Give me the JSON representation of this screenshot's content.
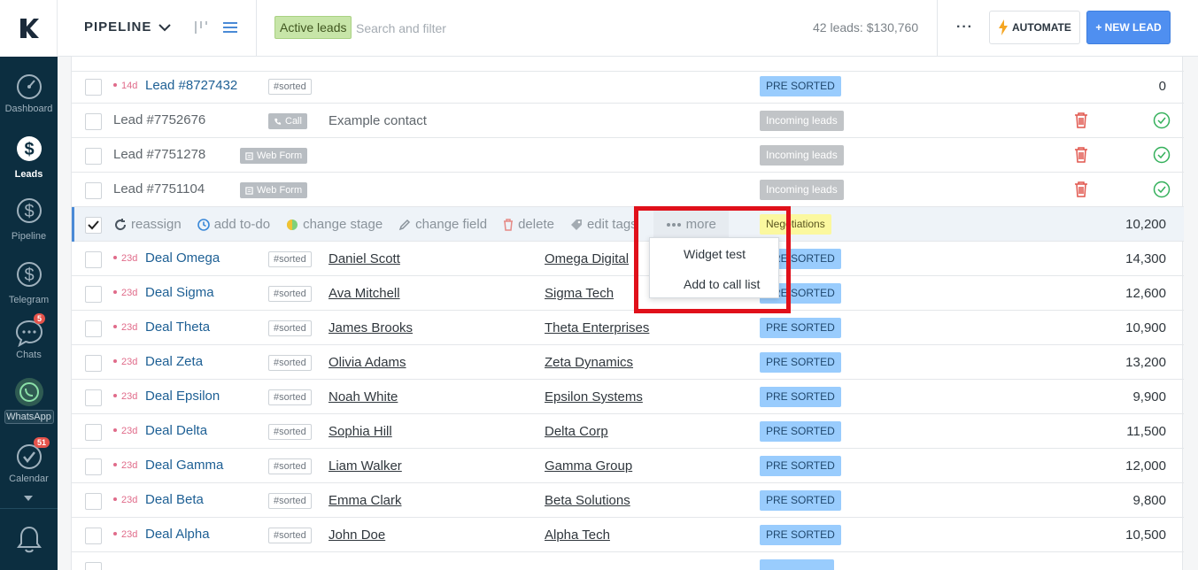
{
  "sidebar": {
    "items": [
      {
        "label": "Dashboard",
        "icon": "dashboard-icon"
      },
      {
        "label": "Leads",
        "icon": "dollar-icon"
      },
      {
        "label": "Pipeline",
        "icon": "dollar-icon"
      },
      {
        "label": "Telegram",
        "icon": "dollar-icon"
      },
      {
        "label": "Chats",
        "icon": "chat-icon",
        "badge": "5"
      },
      {
        "label": "WhatsApp",
        "icon": "whatsapp-icon"
      },
      {
        "label": "Calendar",
        "icon": "check-circle-icon",
        "badge": "51"
      }
    ]
  },
  "header": {
    "pipeline_title": "PIPELINE",
    "filter_chip": "Active leads",
    "search_placeholder": "Search and filter",
    "leads_total": "42 leads: $130,760",
    "more_label": "···",
    "automate_label": "AUTOMATE",
    "new_lead_label": "+ NEW LEAD"
  },
  "bulk_actions": {
    "reassign": "reassign",
    "add_todo": "add to-do",
    "change_stage": "change stage",
    "change_field": "change field",
    "delete": "delete",
    "edit_tags": "edit tags",
    "more": "more"
  },
  "more_menu": {
    "items": [
      "Widget test",
      "Add to call list"
    ]
  },
  "rows": [
    {
      "age": "14d",
      "name": "Lead #8727432",
      "tag": "#sorted",
      "contact": "",
      "company": "",
      "stage": "PRE SORTED",
      "amount": "0"
    },
    {
      "name": "Lead #7752676",
      "source": "Call",
      "contact": "Example contact",
      "stage": "Incoming leads"
    },
    {
      "name": "Lead #7751278",
      "source": "Web Form",
      "stage": "Incoming leads"
    },
    {
      "name": "Lead #7751104",
      "source": "Web Form",
      "stage": "Incoming leads"
    },
    {
      "stage": "Negotiations",
      "amount": "10,200"
    },
    {
      "age": "23d",
      "name": "Deal Omega",
      "tag": "#sorted",
      "contact": "Daniel Scott",
      "company": "Omega Digital",
      "stage": "PRE SORTED",
      "amount": "14,300"
    },
    {
      "age": "23d",
      "name": "Deal Sigma",
      "tag": "#sorted",
      "contact": "Ava Mitchell",
      "company": "Sigma Tech",
      "stage": "PRE SORTED",
      "amount": "12,600"
    },
    {
      "age": "23d",
      "name": "Deal Theta",
      "tag": "#sorted",
      "contact": "James Brooks",
      "company": "Theta Enterprises",
      "stage": "PRE SORTED",
      "amount": "10,900"
    },
    {
      "age": "23d",
      "name": "Deal Zeta",
      "tag": "#sorted",
      "contact": "Olivia Adams",
      "company": "Zeta Dynamics",
      "stage": "PRE SORTED",
      "amount": "13,200"
    },
    {
      "age": "23d",
      "name": "Deal Epsilon",
      "tag": "#sorted",
      "contact": "Noah White",
      "company": "Epsilon Systems",
      "stage": "PRE SORTED",
      "amount": "9,900"
    },
    {
      "age": "23d",
      "name": "Deal Delta",
      "tag": "#sorted",
      "contact": "Sophia Hill",
      "company": "Delta Corp",
      "stage": "PRE SORTED",
      "amount": "11,500"
    },
    {
      "age": "23d",
      "name": "Deal Gamma",
      "tag": "#sorted",
      "contact": "Liam Walker",
      "company": "Gamma Group",
      "stage": "PRE SORTED",
      "amount": "12,000"
    },
    {
      "age": "23d",
      "name": "Deal Beta",
      "tag": "#sorted",
      "contact": "Emma Clark",
      "company": "Beta Solutions",
      "stage": "PRE SORTED",
      "amount": "9,800"
    },
    {
      "age": "23d",
      "name": "Deal Alpha",
      "tag": "#sorted",
      "contact": "John Doe",
      "company": "Alpha Tech",
      "stage": "PRE SORTED",
      "amount": "10,500"
    }
  ],
  "colors": {
    "sidebar_bg": "#0c2e40",
    "accent_blue": "#4f8ff0",
    "pre_sorted": "#99ccfd",
    "negotiations": "#fbf89f",
    "highlight_red": "#e0101a"
  }
}
